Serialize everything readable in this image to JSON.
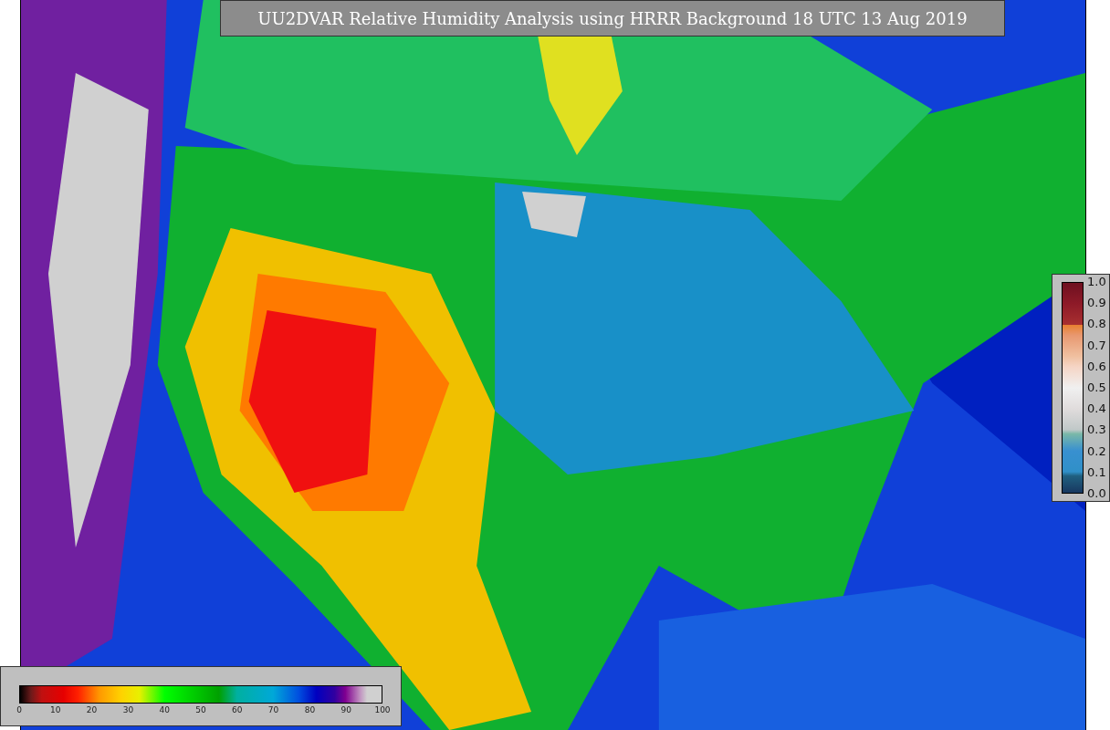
{
  "title": "UU2DVAR Relative Humidity Analysis using HRRR Background 18 UTC 13 Aug 2019",
  "humidity_colorbar": {
    "ticks": [
      "0",
      "10",
      "20",
      "30",
      "40",
      "50",
      "60",
      "70",
      "80",
      "90",
      "100"
    ]
  },
  "value_colorbar": {
    "ticks": [
      "1.0",
      "0.9",
      "0.8",
      "0.7",
      "0.6",
      "0.5",
      "0.4",
      "0.3",
      "0.2",
      "0.1",
      "0.0"
    ]
  }
}
